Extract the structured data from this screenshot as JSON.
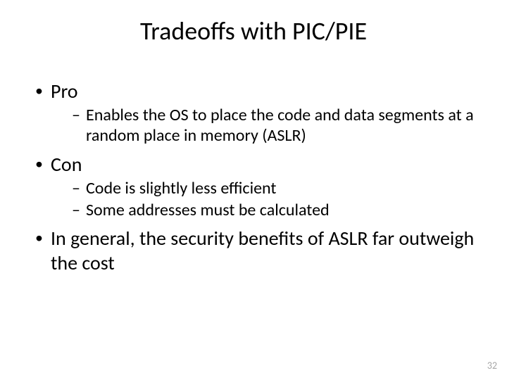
{
  "title": "Tradeoffs with PIC/PIE",
  "bullets": {
    "b1": "Pro",
    "b1_1": "Enables the OS to place the code and data segments at a random place in memory (ASLR)",
    "b2": "Con",
    "b2_1": "Code is slightly less efficient",
    "b2_2": "Some addresses must be calculated",
    "b3": "In general, the security benefits of ASLR far outweigh the cost"
  },
  "page_number": "32"
}
